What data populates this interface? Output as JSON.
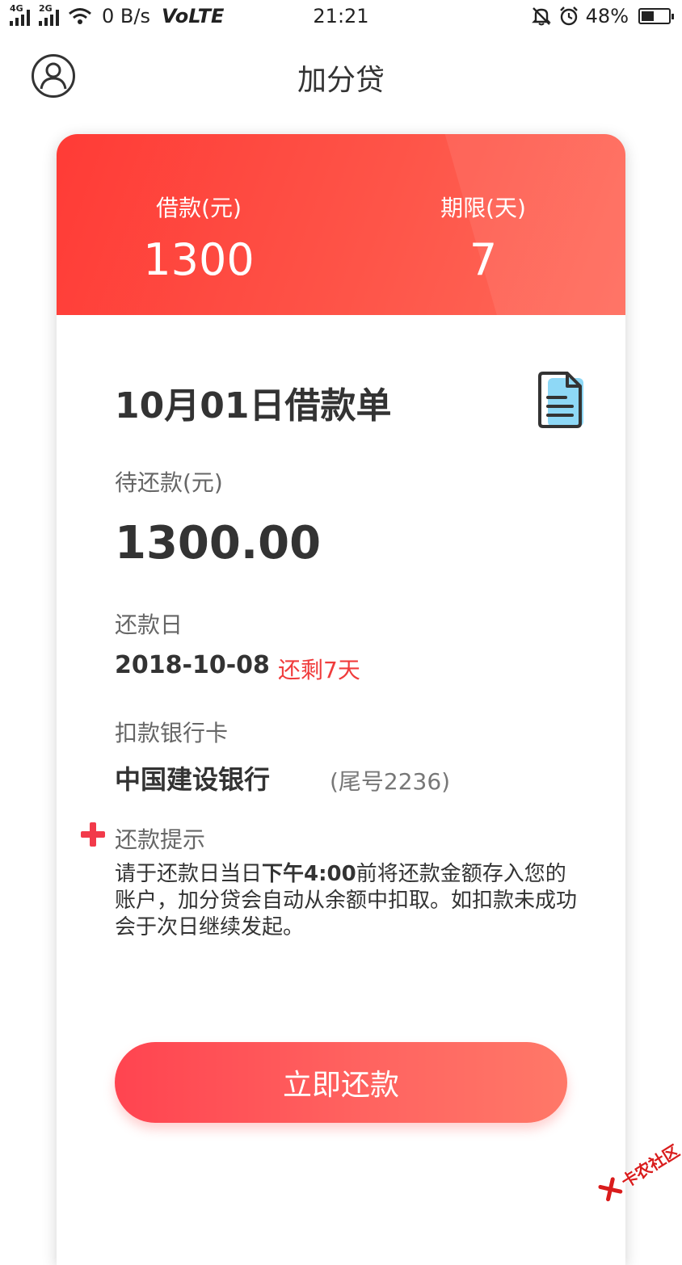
{
  "status_bar": {
    "net1": "4G",
    "net2": "2G",
    "speed": "0 B/s",
    "volte": "VoLTE",
    "time": "21:21",
    "battery": "48%",
    "battery_level": 0.48
  },
  "header": {
    "title": "加分贷"
  },
  "summary": {
    "loan_label": "借款(元)",
    "loan_value": "1300",
    "term_label": "期限(天)",
    "term_value": "7"
  },
  "loan": {
    "title": "10月01日借款单",
    "pending_label": "待还款(元)",
    "pending_amount": "1300.00",
    "due_label": "还款日",
    "due_date": "2018-10-08",
    "days_left": "还剩7天",
    "bank_label": "扣款银行卡",
    "bank_name": "中国建设银行",
    "bank_tail": "(尾号2236)"
  },
  "tip": {
    "label": "还款提示",
    "text_before": "请于还款日当日",
    "text_bold": "下午4:00",
    "text_after": "前将还款金额存入您的账户，加分贷会自动从余额中扣取。如扣款未成功会于次日继续发起。"
  },
  "action": {
    "repay_label": "立即还款"
  },
  "watermark": {
    "text": "卡农社区"
  },
  "colors": {
    "accent": "#ff3b36",
    "alert": "#f03c3c",
    "button_start": "#ff4450",
    "button_end": "#ff7868"
  }
}
